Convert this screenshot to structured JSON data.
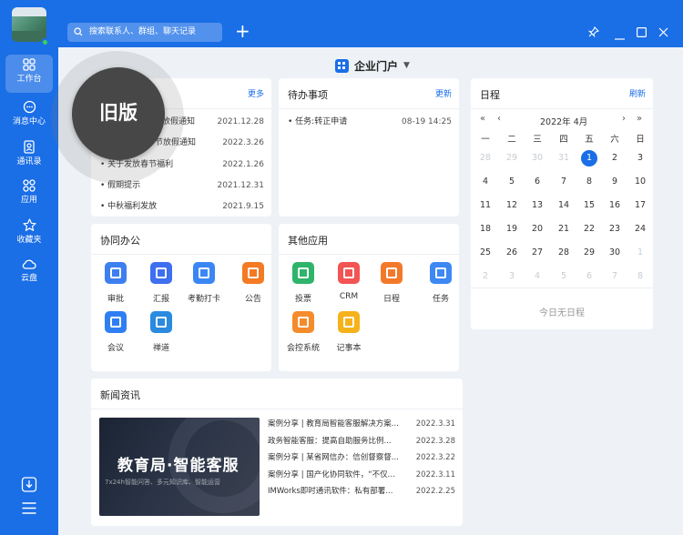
{
  "search": {
    "placeholder": "搜索联系人、群组、聊天记录"
  },
  "sidebar": {
    "items": [
      {
        "label": "工作台",
        "icon": "grid-icon"
      },
      {
        "label": "消息中心",
        "icon": "chat-icon"
      },
      {
        "label": "通讯录",
        "icon": "contacts-icon"
      },
      {
        "label": "应用",
        "icon": "apps-icon"
      },
      {
        "label": "收藏夹",
        "icon": "star-icon"
      },
      {
        "label": "云盘",
        "icon": "cloud-icon"
      }
    ]
  },
  "portal": {
    "title": "企业门户"
  },
  "old_version": {
    "label": "旧版"
  },
  "notice": {
    "more": "更多",
    "items": [
      {
        "title": "春节放假通知",
        "date": "2021.12.28"
      },
      {
        "title": "节放假通知",
        "date": "2022.3.26"
      },
      {
        "title": "关于发放春节福利",
        "date": "2022.1.26"
      },
      {
        "title": "假期提示",
        "date": "2021.12.31"
      },
      {
        "title": "中秋福利发放",
        "date": "2021.9.15"
      }
    ]
  },
  "todo": {
    "title": "待办事项",
    "refresh": "更新",
    "items": [
      {
        "title": "任务:转正申请",
        "time": "08-19 14:25"
      }
    ]
  },
  "schedule": {
    "title": "日程",
    "refresh": "刷新",
    "month": "2022年 4月",
    "weekdays": [
      "一",
      "二",
      "三",
      "四",
      "五",
      "六",
      "日"
    ],
    "today": "1",
    "empty": "今日无日程",
    "weeks": [
      [
        "28",
        "29",
        "30",
        "31",
        "1",
        "2",
        "3"
      ],
      [
        "4",
        "5",
        "6",
        "7",
        "8",
        "9",
        "10"
      ],
      [
        "11",
        "12",
        "13",
        "14",
        "15",
        "16",
        "17"
      ],
      [
        "18",
        "19",
        "20",
        "21",
        "22",
        "23",
        "24"
      ],
      [
        "25",
        "26",
        "27",
        "28",
        "29",
        "30",
        "1"
      ],
      [
        "2",
        "3",
        "4",
        "5",
        "6",
        "7",
        "8"
      ]
    ]
  },
  "collab": {
    "title": "协同办公",
    "apps": [
      {
        "label": "审批",
        "color": "#3d7ff0"
      },
      {
        "label": "汇报",
        "color": "#3d6ff0"
      },
      {
        "label": "考勤打卡",
        "color": "#3b86f5"
      },
      {
        "label": "公告",
        "color": "#f47a23"
      },
      {
        "label": "会议",
        "color": "#2f7ff2"
      },
      {
        "label": "禅道",
        "color": "#2a8ae0"
      }
    ]
  },
  "other": {
    "title": "其他应用",
    "apps": [
      {
        "label": "投票",
        "color": "#2fb46b"
      },
      {
        "label": "CRM",
        "color": "#f25553"
      },
      {
        "label": "日程",
        "color": "#f3792a"
      },
      {
        "label": "任务",
        "color": "#3d88f3"
      },
      {
        "label": "会控系统",
        "color": "#f58b2b"
      },
      {
        "label": "记事本",
        "color": "#f6b21b"
      }
    ]
  },
  "news": {
    "title": "新闻资讯",
    "banner_title": "教育局·智能客服",
    "banner_sub": "7x24h智能问答、多元知识库、智能运营",
    "items": [
      {
        "title": "案例分享 | 教育局智能客服解决方案...",
        "date": "2022.3.31"
      },
      {
        "title": "政务智能客服：提高自助服务比例...",
        "date": "2022.3.28"
      },
      {
        "title": "案例分享 | 某省网信办：信创督察督...",
        "date": "2022.3.22"
      },
      {
        "title": "案例分享 | 国产化协同软件，“不仅...",
        "date": "2022.3.11"
      },
      {
        "title": "IMWorks即时通讯软件：私有部署...",
        "date": "2022.2.25"
      }
    ]
  }
}
